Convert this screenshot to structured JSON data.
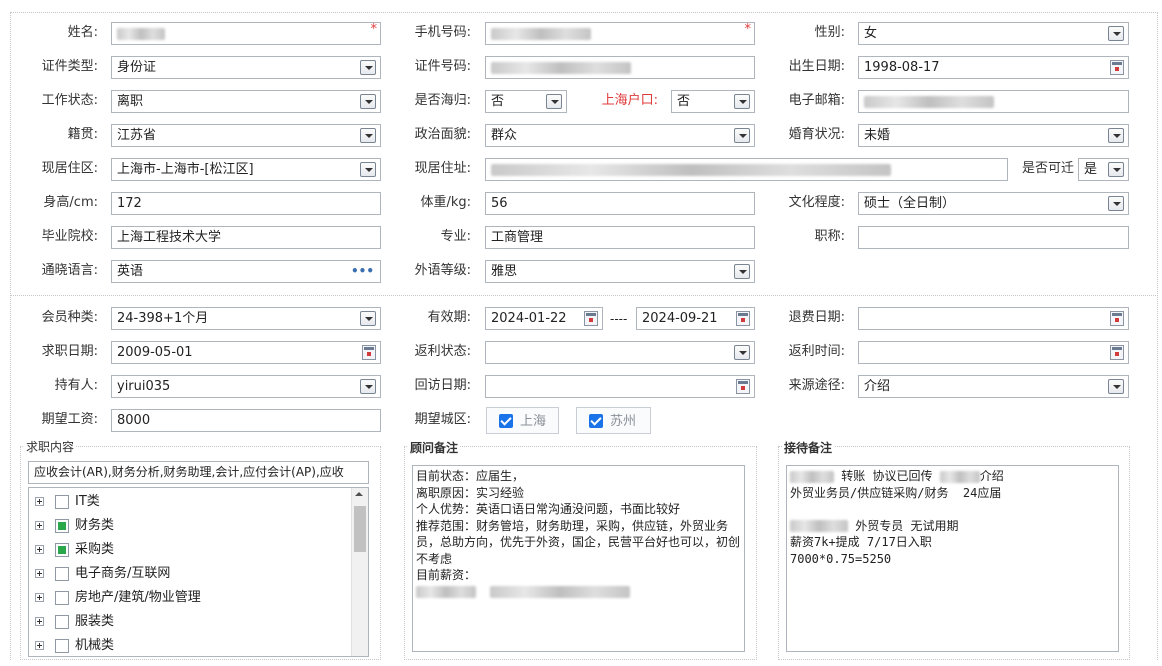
{
  "section1": {
    "name": {
      "label": "姓名:"
    },
    "phone": {
      "label": "手机号码:"
    },
    "gender": {
      "label": "性别:",
      "value": "女"
    },
    "id_type": {
      "label": "证件类型:",
      "value": "身份证"
    },
    "id_number": {
      "label": "证件号码:"
    },
    "birth_date": {
      "label": "出生日期:",
      "value": "1998-08-17"
    },
    "work_status": {
      "label": "工作状态:",
      "value": "离职"
    },
    "returnee": {
      "label": "是否海归:",
      "value": "否"
    },
    "shanghai_hukou": {
      "label": "上海户口:",
      "value": "否"
    },
    "email": {
      "label": "电子邮箱:"
    },
    "native_place": {
      "label": "籍贯:",
      "value": "江苏省"
    },
    "political": {
      "label": "政治面貌:",
      "value": "群众"
    },
    "marital": {
      "label": "婚育状况:",
      "value": "未婚"
    },
    "residence_area": {
      "label": "现居住区:",
      "value": "上海市-上海市-[松江区]"
    },
    "residence_address": {
      "label": "现居住址:"
    },
    "relocate": {
      "label": "是否可迁",
      "value": "是"
    },
    "height": {
      "label": "身高/cm:",
      "value": "172"
    },
    "weight": {
      "label": "体重/kg:",
      "value": "56"
    },
    "education": {
      "label": "文化程度:",
      "value": "硕士（全日制）"
    },
    "school": {
      "label": "毕业院校:",
      "value": "上海工程技术大学"
    },
    "major": {
      "label": "专业:",
      "value": "工商管理"
    },
    "title": {
      "label": "职称:",
      "value": ""
    },
    "languages": {
      "label": "通晓语言:",
      "value": "英语"
    },
    "language_level": {
      "label": "外语等级:",
      "value": "雅思"
    }
  },
  "section2": {
    "member_type": {
      "label": "会员种类:",
      "value": "24-398+1个月"
    },
    "valid_period": {
      "label": "有效期:",
      "from": "2024-01-22",
      "sep": "----",
      "to": "2024-09-21"
    },
    "refund_date": {
      "label": "退费日期:",
      "value": ""
    },
    "job_search_date": {
      "label": "求职日期:",
      "value": "2009-05-01"
    },
    "rebate_status": {
      "label": "返利状态:",
      "value": ""
    },
    "rebate_time": {
      "label": "返利时间:",
      "value": ""
    },
    "holder": {
      "label": "持有人:",
      "value": "yirui035"
    },
    "visit_date": {
      "label": "回访日期:",
      "value": ""
    },
    "source": {
      "label": "来源途径:",
      "value": "介绍"
    },
    "expected_salary": {
      "label": "期望工资:",
      "value": "8000"
    },
    "expected_city": {
      "label": "期望城区:",
      "options": [
        "上海",
        "苏州"
      ]
    }
  },
  "job_content": {
    "legend": "求职内容",
    "summary": "应收会计(AR),财务分析,财务助理,会计,应付会计(AP),应收",
    "tree": [
      {
        "label": "IT类",
        "checked": false
      },
      {
        "label": "财务类",
        "checked": true
      },
      {
        "label": "采购类",
        "checked": true
      },
      {
        "label": "电子商务/互联网",
        "checked": false
      },
      {
        "label": "房地产/建筑/物业管理",
        "checked": false
      },
      {
        "label": "服装类",
        "checked": false
      },
      {
        "label": "机械类",
        "checked": false
      }
    ]
  },
  "advisor_notes": {
    "legend": "顾问备注",
    "text": "目前状态：应届生，\n离职原因：实习经验\n个人优势：英语口语日常沟通没问题，书面比较好\n推荐范围：财务管培，财务助理，采购，供应链，外贸业务员，总助方向，优先于外资，国企，民营平台好也可以，初创不考虑\n目前薪资："
  },
  "reception_notes": {
    "legend": "接待备注",
    "line1_a": "转账 协议已回传",
    "line1_b": "介绍",
    "line2": "外贸业务员/供应链采购/财务  24应届",
    "line4": "外贸专员 无试用期",
    "line5": "薪资7k+提成 7/17日入职",
    "line6": "7000*0.75=5250"
  }
}
